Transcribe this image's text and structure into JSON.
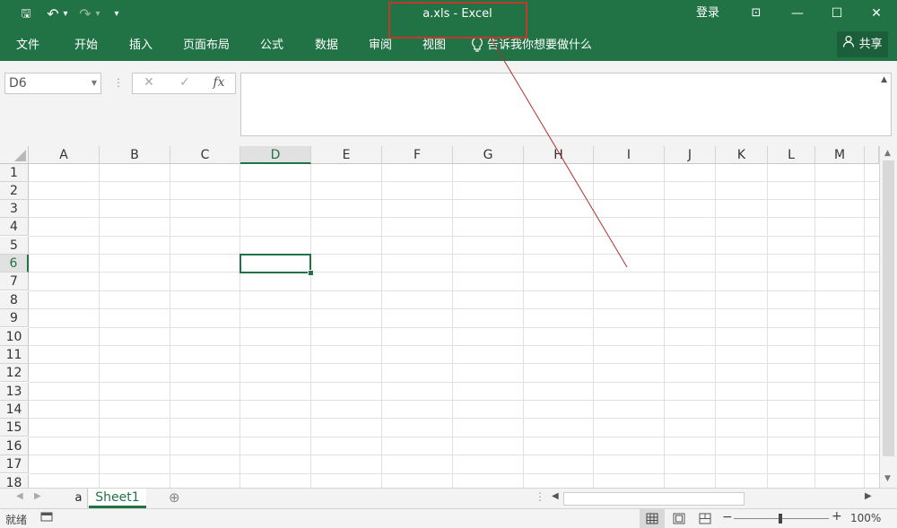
{
  "window": {
    "title": "a.xls  -  Excel",
    "signin": "登录",
    "buttons": {
      "ribbon_options": "⊡",
      "minimize": "—",
      "maximize": "☐",
      "close": "✕"
    }
  },
  "qat": {
    "save": "🖫",
    "undo": "↶",
    "undo_more": "▾",
    "redo": "↷",
    "redo_more": "▾",
    "customize": "▾"
  },
  "ribbon": {
    "tabs": [
      "文件",
      "开始",
      "插入",
      "页面布局",
      "公式",
      "数据",
      "审阅",
      "视图"
    ],
    "tell_me": "告诉我你想要做什么",
    "share": "共享"
  },
  "formula_bar": {
    "name_box": "D6",
    "cancel": "✕",
    "enter": "✓",
    "fx": "fx",
    "value": ""
  },
  "grid": {
    "columns": [
      "A",
      "B",
      "C",
      "D",
      "E",
      "F",
      "G",
      "H",
      "I",
      "J",
      "K",
      "L",
      "M"
    ],
    "rows": [
      "1",
      "2",
      "3",
      "4",
      "5",
      "6",
      "7",
      "8",
      "9",
      "10",
      "11",
      "12",
      "13",
      "14",
      "15",
      "16",
      "17",
      "18"
    ],
    "selected_cell": "D6"
  },
  "sheets": {
    "tabs": [
      "a",
      "Sheet1"
    ],
    "active": "Sheet1",
    "add": "⊕"
  },
  "status": {
    "ready": "就绪",
    "zoom": "100%"
  },
  "colors": {
    "accent": "#217346",
    "annotation": "#c0392b"
  }
}
